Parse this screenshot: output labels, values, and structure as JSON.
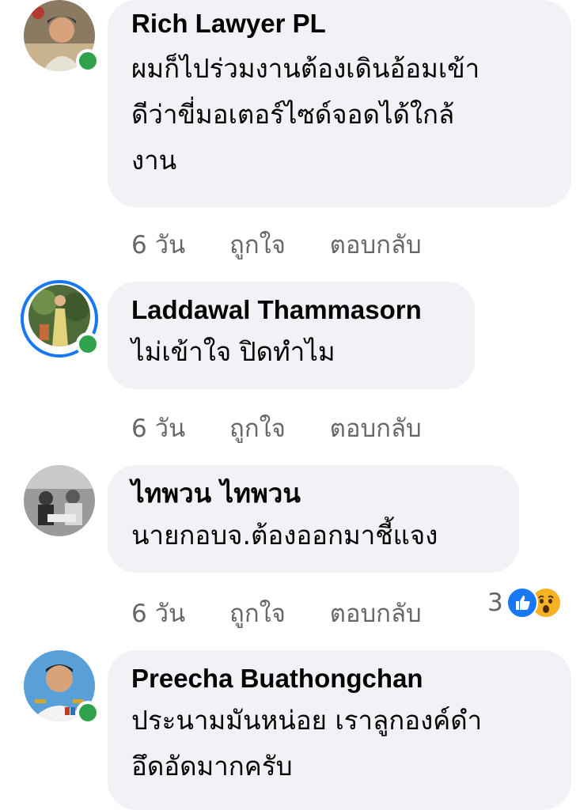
{
  "comments": [
    {
      "author": "Rich Lawyer PL",
      "text_lines": [
        "ผมก็ไปร่วมงานต้องเดินอ้อมเข้า",
        "ดีว่าขี่มอเตอร์ไซด์จอดได้ใกล้",
        "งาน"
      ],
      "time": "6 วัน",
      "like_label": "ถูกใจ",
      "reply_label": "ตอบกลับ",
      "online": true
    },
    {
      "author": "Laddawal Thammasorn",
      "text_lines": [
        "ไม่เข้าใจ ปิดทำไม"
      ],
      "time": "6 วัน",
      "like_label": "ถูกใจ",
      "reply_label": "ตอบกลับ",
      "online": true,
      "has_story": true
    },
    {
      "author": "ไทพวน ไทพวน",
      "text_lines": [
        "นายกอบจ.ต้องออกมาชี้แจง"
      ],
      "time": "6 วัน",
      "like_label": "ถูกใจ",
      "reply_label": "ตอบกลับ",
      "online": false,
      "reactions": {
        "count": "3",
        "icons": [
          "like-icon",
          "wow-icon"
        ]
      }
    },
    {
      "author": "Preecha Buathongchan",
      "text_lines": [
        "ประนามมันหน่อย เราลูกองค์ดำ",
        "อึดอัดมากครับ"
      ],
      "online": true
    }
  ],
  "colors": {
    "bubble": "#f0f2f5",
    "online": "#31a24c",
    "story_ring": "#1877f2",
    "meta_text": "#65676b"
  }
}
